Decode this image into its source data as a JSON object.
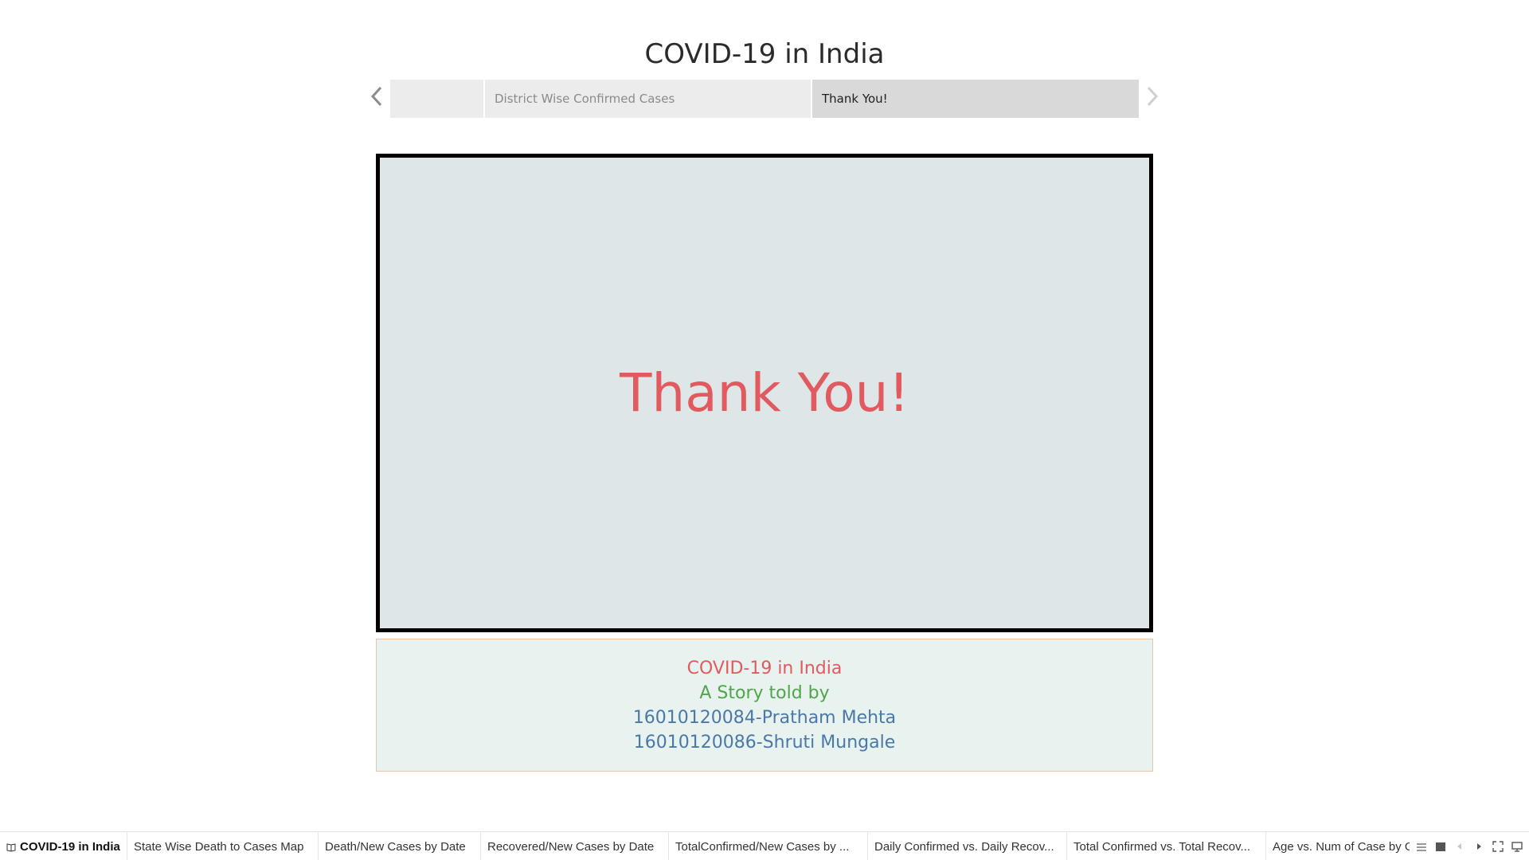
{
  "story": {
    "title": "COVID-19 in India",
    "points": [
      {
        "label": ""
      },
      {
        "label": "District Wise Confirmed Cases"
      },
      {
        "label": "Thank You!"
      }
    ],
    "active_point": 2
  },
  "viz": {
    "text": "Thank You!"
  },
  "caption": {
    "line1": "COVID-19 in India",
    "line2": "A Story told by",
    "line3": "16010120084-Pratham Mehta",
    "line4": "16010120086-Shruti Mungale"
  },
  "tabs": [
    {
      "label": "COVID-19 in India",
      "active": true
    },
    {
      "label": "State Wise Death to Cases Map"
    },
    {
      "label": "Death/New Cases by Date"
    },
    {
      "label": "Recovered/New Cases by Date"
    },
    {
      "label": "TotalConfirmed/New Cases by ..."
    },
    {
      "label": "Daily Confirmed vs. Daily Recov..."
    },
    {
      "label": "Total Confirmed vs. Total Recov..."
    },
    {
      "label": "Age vs. Num of Case by Ge"
    }
  ],
  "icons": {
    "prev": "chevron-left-icon",
    "next": "chevron-right-icon",
    "story_tab": "story-book-icon",
    "controls": [
      "sheet-sorter-icon",
      "filmstrip-icon",
      "previous-sheet-icon",
      "next-sheet-icon",
      "fullscreen-icon",
      "presentation-icon"
    ]
  },
  "colors": {
    "frame_bg": "#dfe6e8",
    "thankyou_red": "#e05a5f",
    "caption_green": "#4fa64a",
    "caption_blue": "#4a78a8",
    "caption_bg": "#e8f2ef"
  }
}
